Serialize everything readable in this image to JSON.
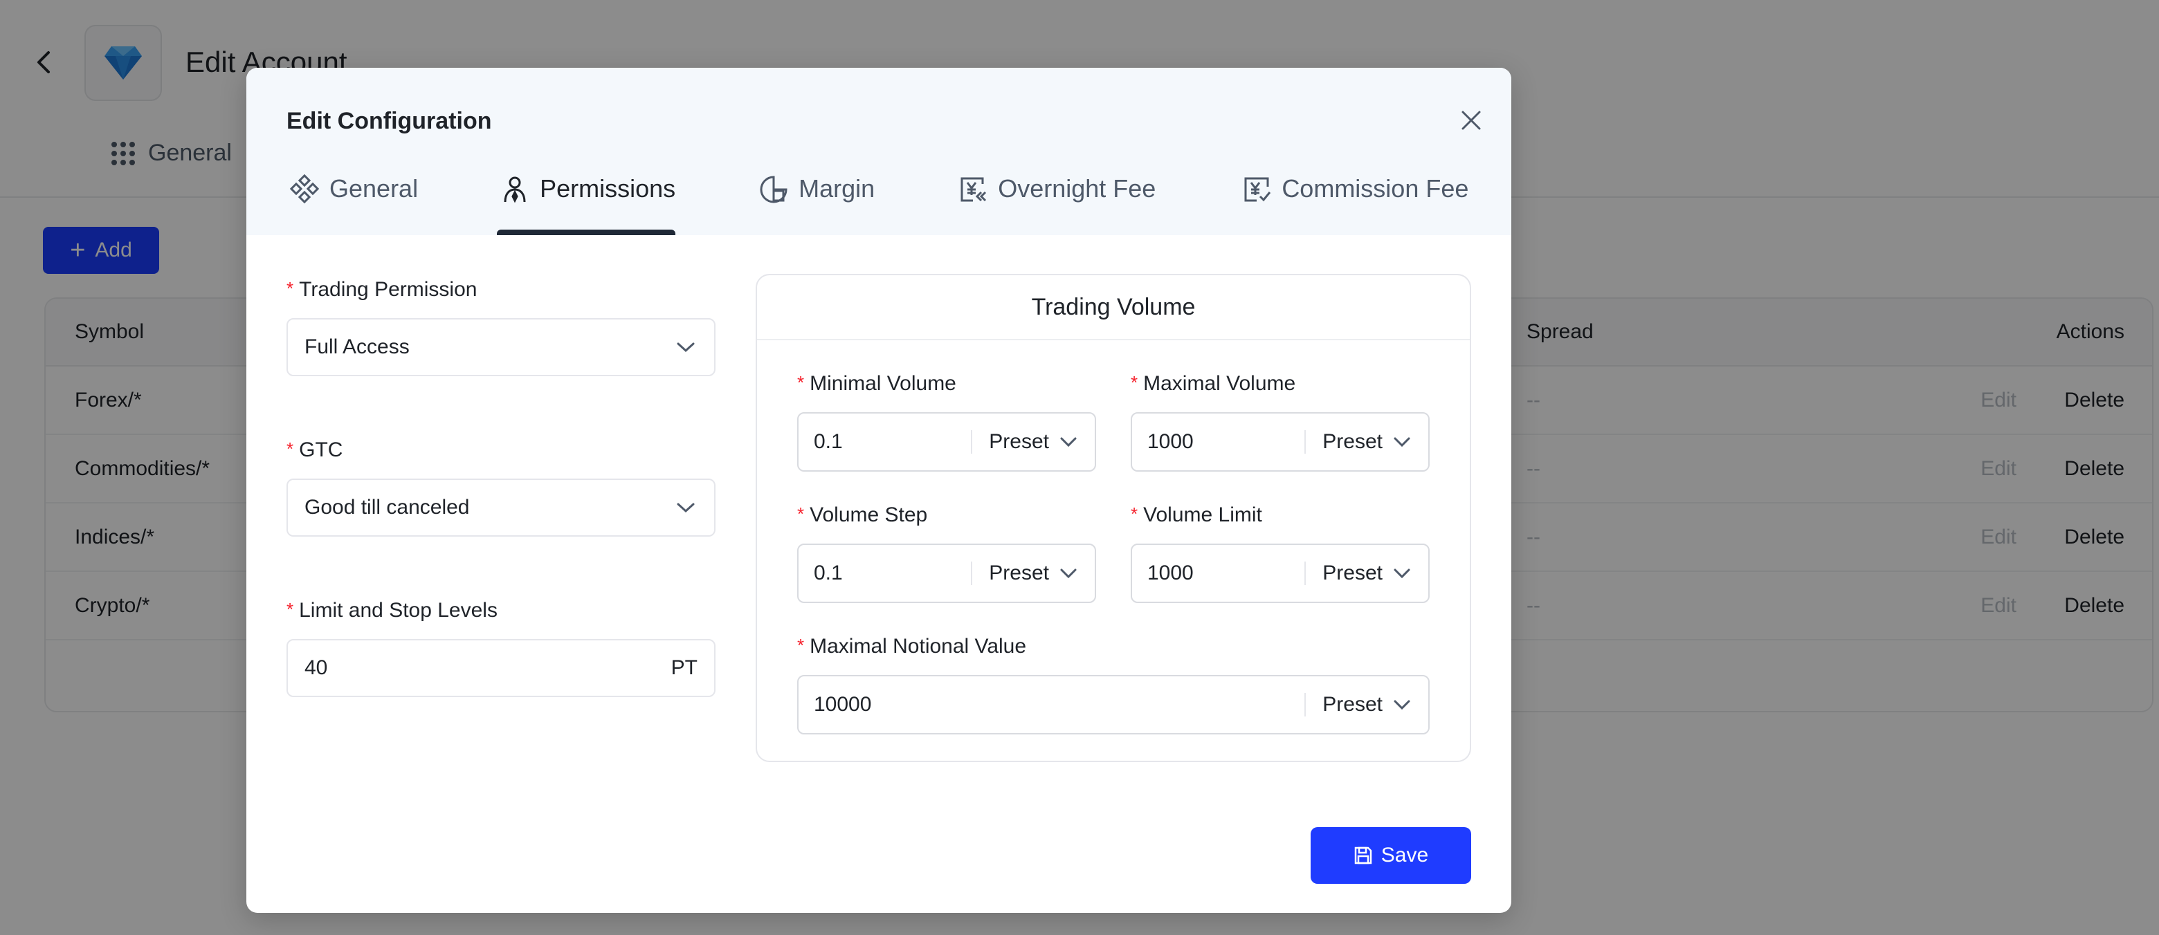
{
  "background": {
    "title": "Edit Account",
    "tab_label": "General",
    "add_label": "Add",
    "table": {
      "headers": {
        "symbol": "Symbol",
        "spread": "Spread",
        "actions": "Actions"
      },
      "rows": [
        {
          "symbol": "Forex/*",
          "spread": "--",
          "edit": "Edit",
          "delete": "Delete"
        },
        {
          "symbol": "Commodities/*",
          "spread": "--",
          "edit": "Edit",
          "delete": "Delete"
        },
        {
          "symbol": "Indices/*",
          "spread": "--",
          "edit": "Edit",
          "delete": "Delete"
        },
        {
          "symbol": "Crypto/*",
          "spread": "--",
          "edit": "Edit",
          "delete": "Delete"
        }
      ]
    }
  },
  "modal": {
    "title": "Edit Configuration",
    "tabs": [
      {
        "label": "General",
        "icon": "general-icon"
      },
      {
        "label": "Permissions",
        "icon": "permissions-icon",
        "active": true
      },
      {
        "label": "Margin",
        "icon": "margin-icon"
      },
      {
        "label": "Overnight Fee",
        "icon": "overnight-fee-icon"
      },
      {
        "label": "Commission Fee",
        "icon": "commission-fee-icon"
      }
    ],
    "form": {
      "trading_permission": {
        "label": "Trading Permission",
        "value": "Full Access"
      },
      "gtc": {
        "label": "GTC",
        "value": "Good till canceled"
      },
      "limit_stop": {
        "label": "Limit and Stop Levels",
        "value": "40",
        "suffix": "PT"
      }
    },
    "volume": {
      "title": "Trading Volume",
      "minimal": {
        "label": "Minimal Volume",
        "value": "0.1",
        "preset": "Preset"
      },
      "maximal": {
        "label": "Maximal Volume",
        "value": "1000",
        "preset": "Preset"
      },
      "step": {
        "label": "Volume Step",
        "value": "0.1",
        "preset": "Preset"
      },
      "limit": {
        "label": "Volume Limit",
        "value": "1000",
        "preset": "Preset"
      },
      "notional": {
        "label": "Maximal Notional Value",
        "value": "10000",
        "preset": "Preset"
      }
    },
    "save_label": "Save"
  },
  "colors": {
    "primary": "#1f3cff",
    "required": "#f5222d",
    "header_bg": "#f4f8fc"
  }
}
